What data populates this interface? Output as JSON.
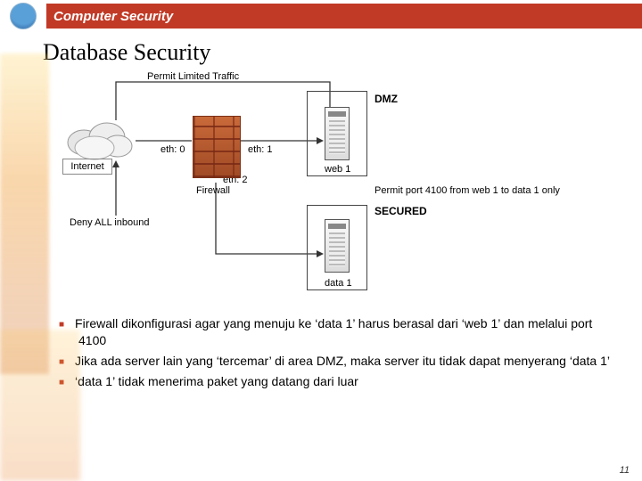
{
  "header": {
    "course_title": "Computer Security"
  },
  "slide": {
    "title": "Database Security",
    "page_number": "11"
  },
  "diagram": {
    "top_note": "Permit Limited Traffic",
    "internet_label": "Internet",
    "eth0": "eth: 0",
    "eth1": "eth: 1",
    "eth2": "eth: 2",
    "firewall_label": "Firewall",
    "deny_inbound": "Deny ALL inbound",
    "dmz_label": "DMZ",
    "web_server": "web 1",
    "secured_label": "SECURED",
    "data_server": "data 1",
    "permit_note": "Permit port 4100 from web 1 to data 1 only"
  },
  "bullets": [
    "Firewall dikonfigurasi agar yang menuju ke ‘data 1’ harus berasal dari ‘web 1’ dan melalui port 4100",
    "Jika ada server lain yang ‘tercemar’ di area DMZ, maka server itu tidak dapat menyerang ‘data 1’",
    "‘data 1’ tidak menerima paket yang datang dari luar"
  ]
}
